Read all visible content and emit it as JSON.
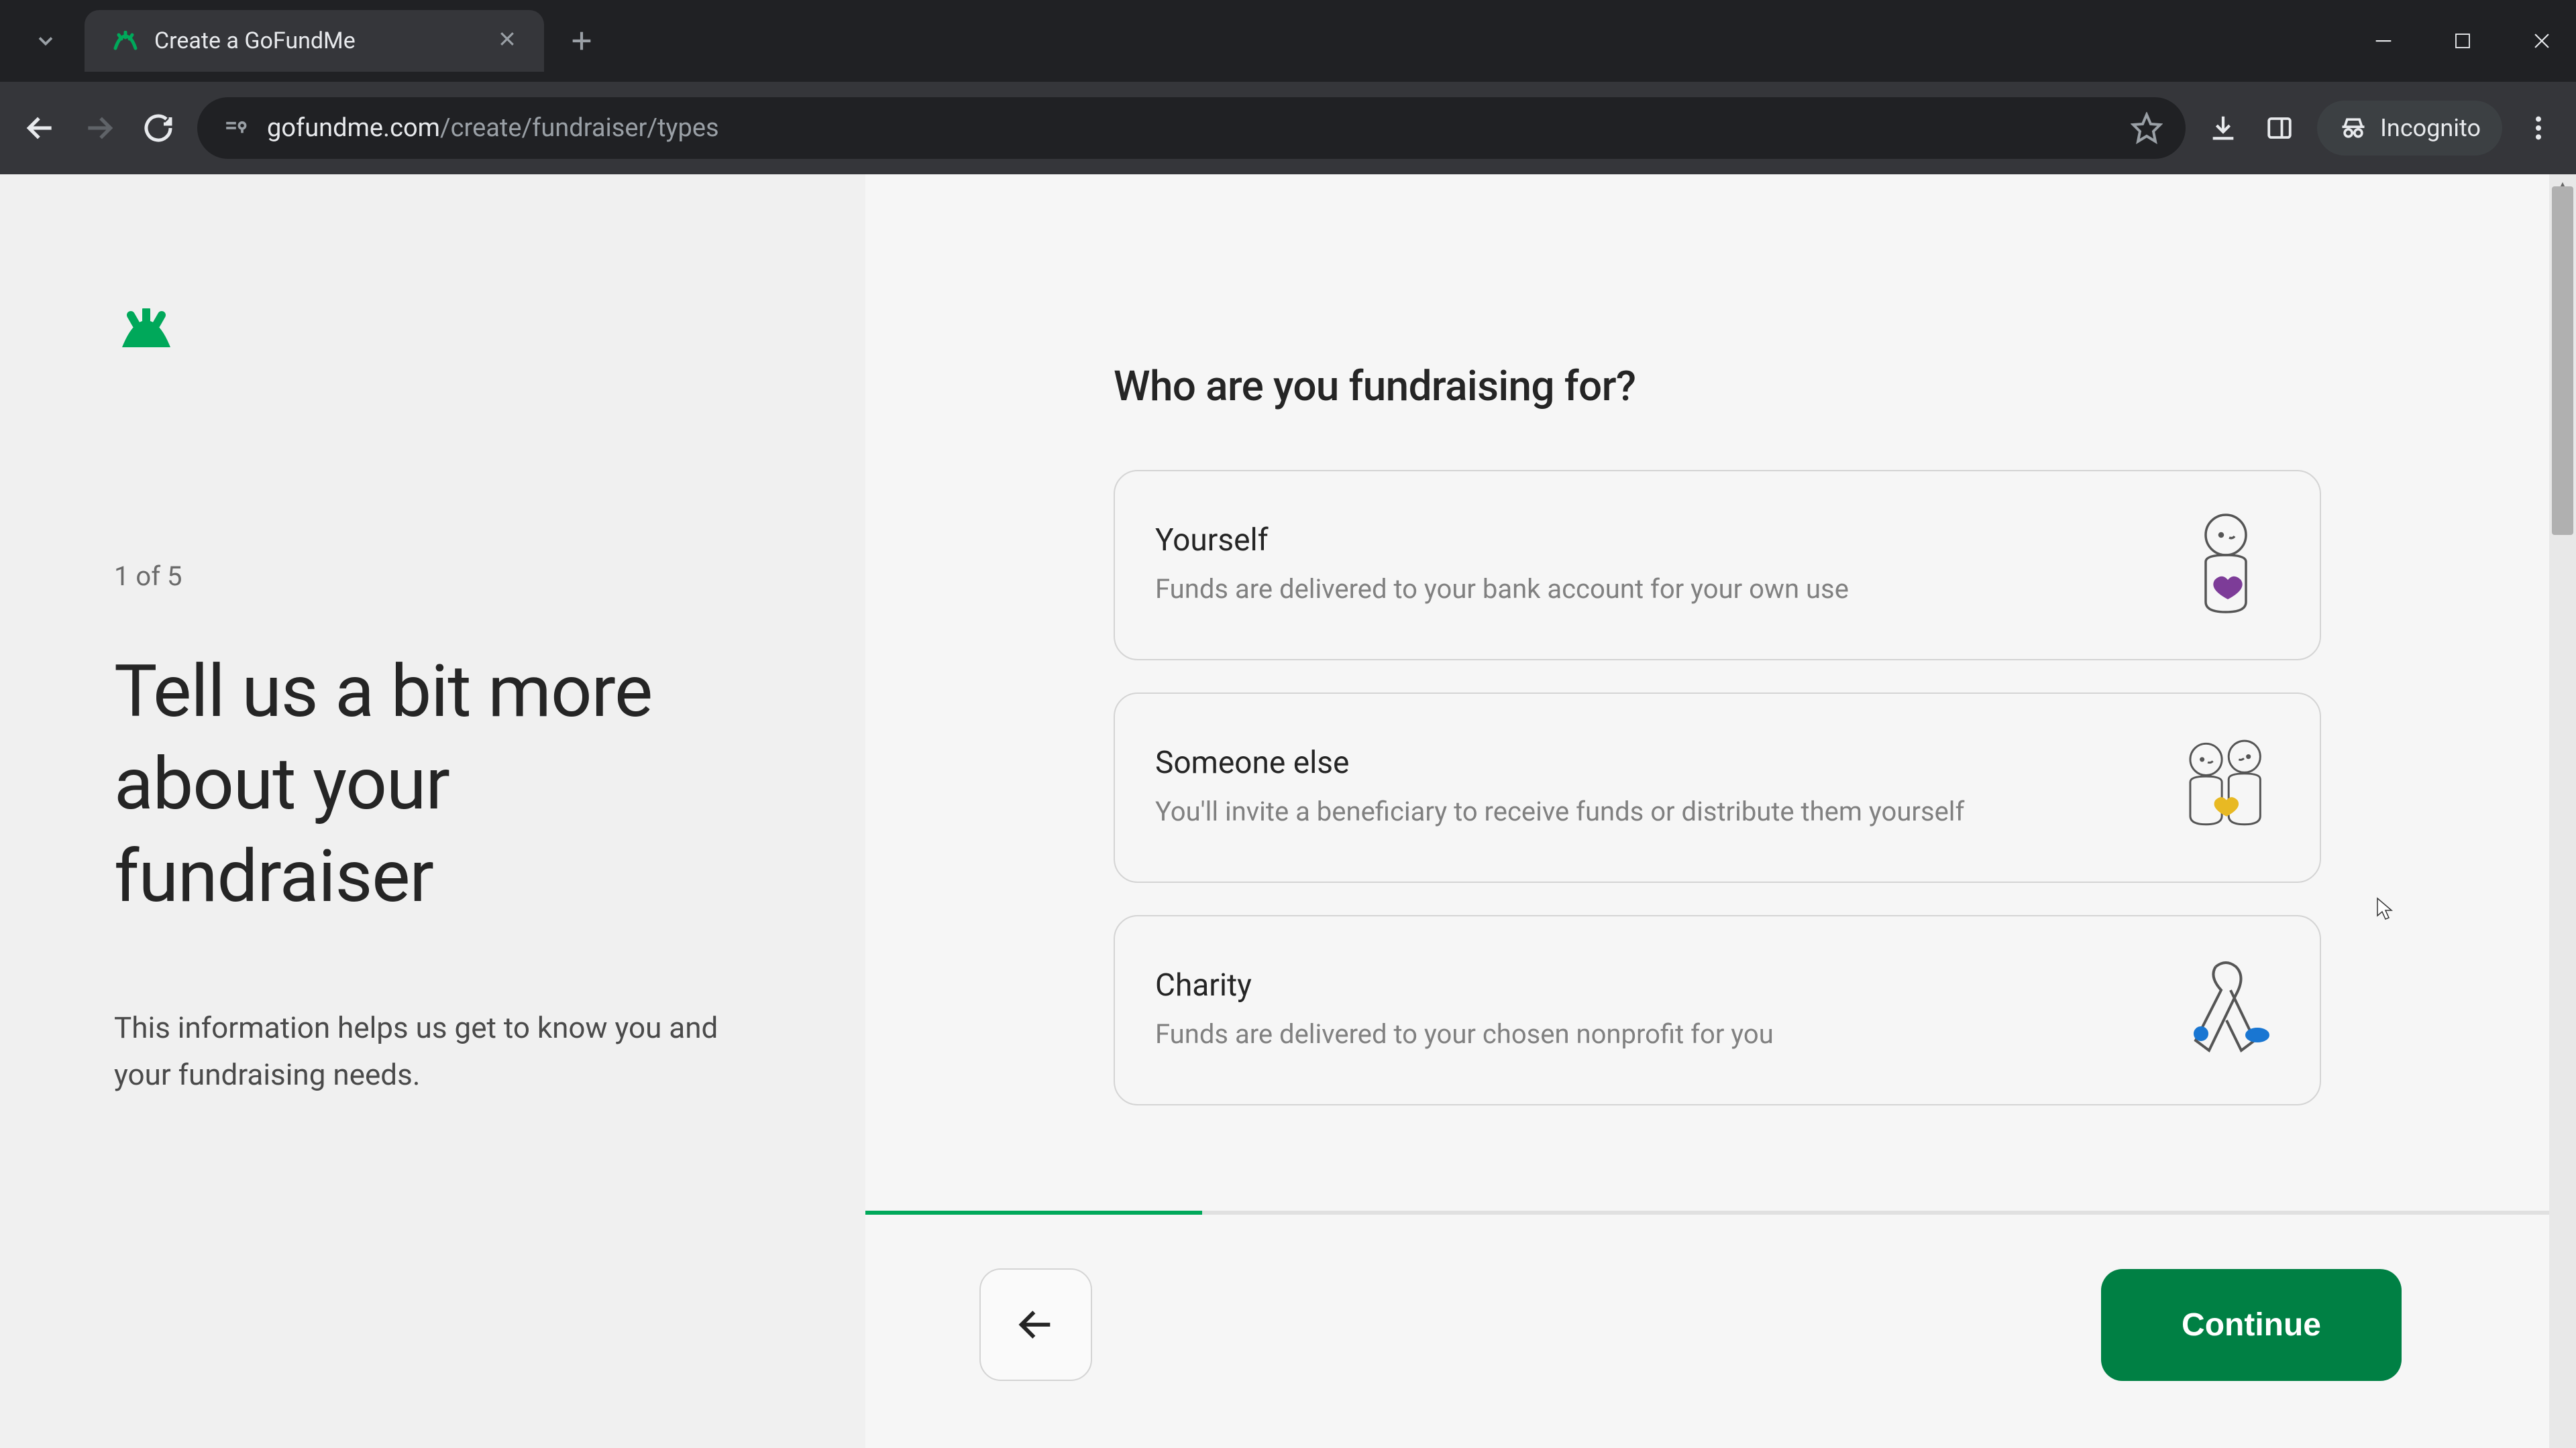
{
  "browser": {
    "tab_title": "Create a GoFundMe",
    "url_domain": "gofundme.com",
    "url_path": "/create/fundraiser/types",
    "incognito_label": "Incognito"
  },
  "sidebar": {
    "step_counter": "1 of 5",
    "headline": "Tell us a bit more about your fundraiser",
    "subhead": "This information helps us get to know you and your fundraising needs."
  },
  "main": {
    "question": "Who are you fundraising for?",
    "options": [
      {
        "title": "Yourself",
        "desc": "Funds are delivered to your bank account for your own use"
      },
      {
        "title": "Someone else",
        "desc": "You'll invite a beneficiary to receive funds or distribute them yourself"
      },
      {
        "title": "Charity",
        "desc": "Funds are delivered to your chosen nonprofit for you"
      }
    ],
    "continue_label": "Continue"
  },
  "progress": {
    "current": 1,
    "total": 5,
    "percent": 20
  },
  "colors": {
    "brand_green": "#00a85a",
    "button_green": "#008044",
    "text_primary": "#252525",
    "text_secondary": "#808080",
    "border": "#d4d4d4",
    "sidebar_bg": "#f0f0f0",
    "main_bg": "#f6f6f6"
  }
}
